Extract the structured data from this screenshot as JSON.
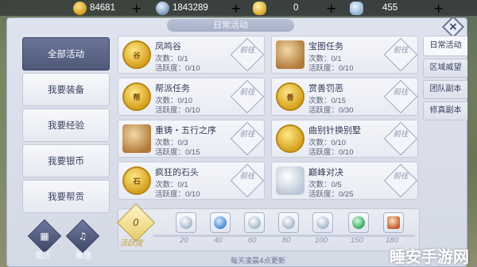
{
  "resources": [
    {
      "icon": "gold-coin-icon",
      "value": "84681"
    },
    {
      "icon": "silver-coin-icon",
      "value": "1843289"
    },
    {
      "icon": "gold-ingot-icon",
      "value": "0"
    },
    {
      "icon": "silver-gem-icon",
      "value": "455"
    }
  ],
  "plus_label": "+",
  "panel": {
    "title": "日常活动",
    "close_label": "×"
  },
  "menu": [
    {
      "label": "全部活动",
      "active": true
    },
    {
      "label": "我要装备",
      "active": false
    },
    {
      "label": "我要经验",
      "active": false
    },
    {
      "label": "我要银币",
      "active": false
    },
    {
      "label": "我要帮贡",
      "active": false
    }
  ],
  "activities": [
    {
      "name": "凤鸣谷",
      "count": "次数：0/1",
      "act": "活跃度：0/10",
      "icon": "coin",
      "icon_text": "谷",
      "goto": "前往"
    },
    {
      "name": "宝图任务",
      "count": "次数：0/1",
      "act": "活跃度：0/10",
      "icon": "scroll",
      "icon_text": "",
      "goto": "前往"
    },
    {
      "name": "帮派任务",
      "count": "次数：0/10",
      "act": "活跃度：0/10",
      "icon": "coin",
      "icon_text": "帮",
      "goto": "前往"
    },
    {
      "name": "赏善罚恶",
      "count": "次数：0/15",
      "act": "活跃度：0/30",
      "icon": "coin",
      "icon_text": "善",
      "goto": "前往"
    },
    {
      "name": "重铸・五行之序",
      "count": "次数：0/3",
      "act": "活跃度：0/15",
      "icon": "scroll",
      "icon_text": "",
      "goto": "前往"
    },
    {
      "name": "曲别针换别墅",
      "count": "次数：0/10",
      "act": "活跃度：0/10",
      "icon": "coin",
      "icon_text": "",
      "goto": "前往"
    },
    {
      "name": "疯狂的石头",
      "count": "次数：0/1",
      "act": "活跃度：0/10",
      "icon": "coin",
      "icon_text": "石",
      "goto": "前往"
    },
    {
      "name": "巅峰对决",
      "count": "次数：0/5",
      "act": "活跃度：0/25",
      "icon": "silverpiece",
      "icon_text": "",
      "goto": "前往"
    }
  ],
  "right_tabs": [
    {
      "label": "日常活动",
      "active": true
    },
    {
      "label": "区域威望",
      "active": false
    },
    {
      "label": "团队副本",
      "active": false
    },
    {
      "label": "修真副本",
      "active": false
    }
  ],
  "progress": {
    "current": "0",
    "label": "活跃度",
    "milestones": [
      "20",
      "40",
      "60",
      "80",
      "100",
      "150",
      "180"
    ],
    "reset_note": "每天凌晨4点更新"
  },
  "bottom_buttons": [
    {
      "label": "周历"
    },
    {
      "label": "推送"
    }
  ],
  "watermark": "睡安手游网"
}
